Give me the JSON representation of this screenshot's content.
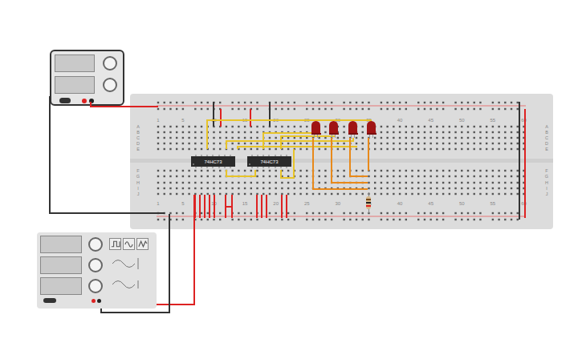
{
  "chips": [
    {
      "label": "74HC73"
    },
    {
      "label": "74HC73"
    }
  ],
  "breadboard": {
    "column_labels": [
      "1",
      "5",
      "10",
      "15",
      "20",
      "25",
      "30",
      "35",
      "40",
      "45",
      "50",
      "55",
      "60"
    ],
    "top_row_labels": [
      "A",
      "B",
      "C",
      "D",
      "E"
    ],
    "bottom_row_labels": [
      "F",
      "G",
      "H",
      "I",
      "J"
    ]
  },
  "leds": [
    {
      "lit": false
    },
    {
      "lit": false
    },
    {
      "lit": false
    },
    {
      "lit": false
    }
  ],
  "function_generator": {
    "waveforms": [
      {
        "kind": "square",
        "selected": false
      },
      {
        "kind": "sine",
        "selected": false
      },
      {
        "kind": "triangle",
        "selected": false
      }
    ]
  }
}
